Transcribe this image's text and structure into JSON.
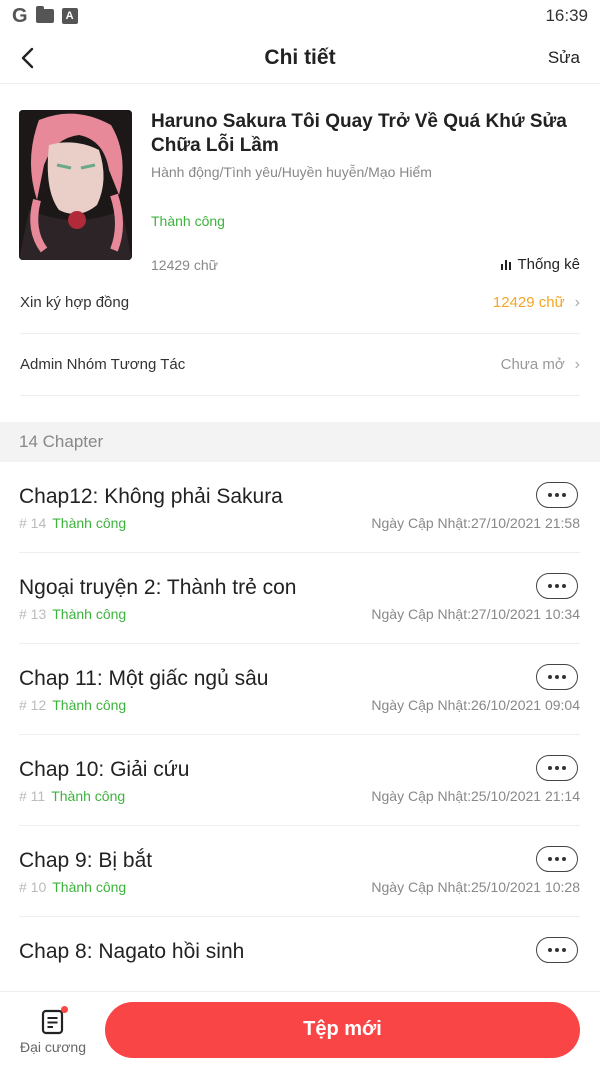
{
  "status_bar": {
    "time": "16:39",
    "g_logo": "G",
    "a_icon": "A"
  },
  "nav": {
    "title": "Chi tiết",
    "edit_label": "Sửa"
  },
  "book": {
    "title": "Haruno Sakura Tôi Quay Trở Về Quá Khứ Sửa Chữa Lỗi Lầm",
    "genre": "Hành động/Tình yêu/Huyền huyễn/Mạo Hiểm",
    "status": "Thành công",
    "word_count": "12429 chữ",
    "stats_label": "Thống kê"
  },
  "settings": [
    {
      "label": "Xin ký hợp đồng",
      "value": "12429 chữ",
      "value_color": "#f5a623"
    },
    {
      "label": "Admin Nhóm Tương Tác",
      "value": "Chưa mở",
      "value_color": "#999999"
    }
  ],
  "chapter_header": "14 Chapter",
  "chapters": [
    {
      "title": "Chap12: Không phải Sakura",
      "num": "# 14",
      "status": "Thành công",
      "date": "Ngày Cập Nhật:27/10/2021 21:58"
    },
    {
      "title": "Ngoại truyện 2: Thành trẻ con",
      "num": "# 13",
      "status": "Thành công",
      "date": "Ngày Cập Nhật:27/10/2021 10:34"
    },
    {
      "title": "Chap 11: Một giấc ngủ sâu",
      "num": "# 12",
      "status": "Thành công",
      "date": "Ngày Cập Nhật:26/10/2021 09:04"
    },
    {
      "title": "Chap 10: Giải cứu",
      "num": "# 11",
      "status": "Thành công",
      "date": "Ngày Cập Nhật:25/10/2021 21:14"
    },
    {
      "title": "Chap 9: Bị bắt",
      "num": "# 10",
      "status": "Thành công",
      "date": "Ngày Cập Nhật:25/10/2021 10:28"
    },
    {
      "title": "Chap 8: Nagato hồi sinh",
      "num": "",
      "status": "",
      "date": ""
    }
  ],
  "bottom": {
    "outline_label": "Đại cương",
    "new_file_label": "Tệp mới"
  },
  "colors": {
    "accent": "#f94545",
    "success": "#3cb43c",
    "highlight": "#f5a623"
  }
}
